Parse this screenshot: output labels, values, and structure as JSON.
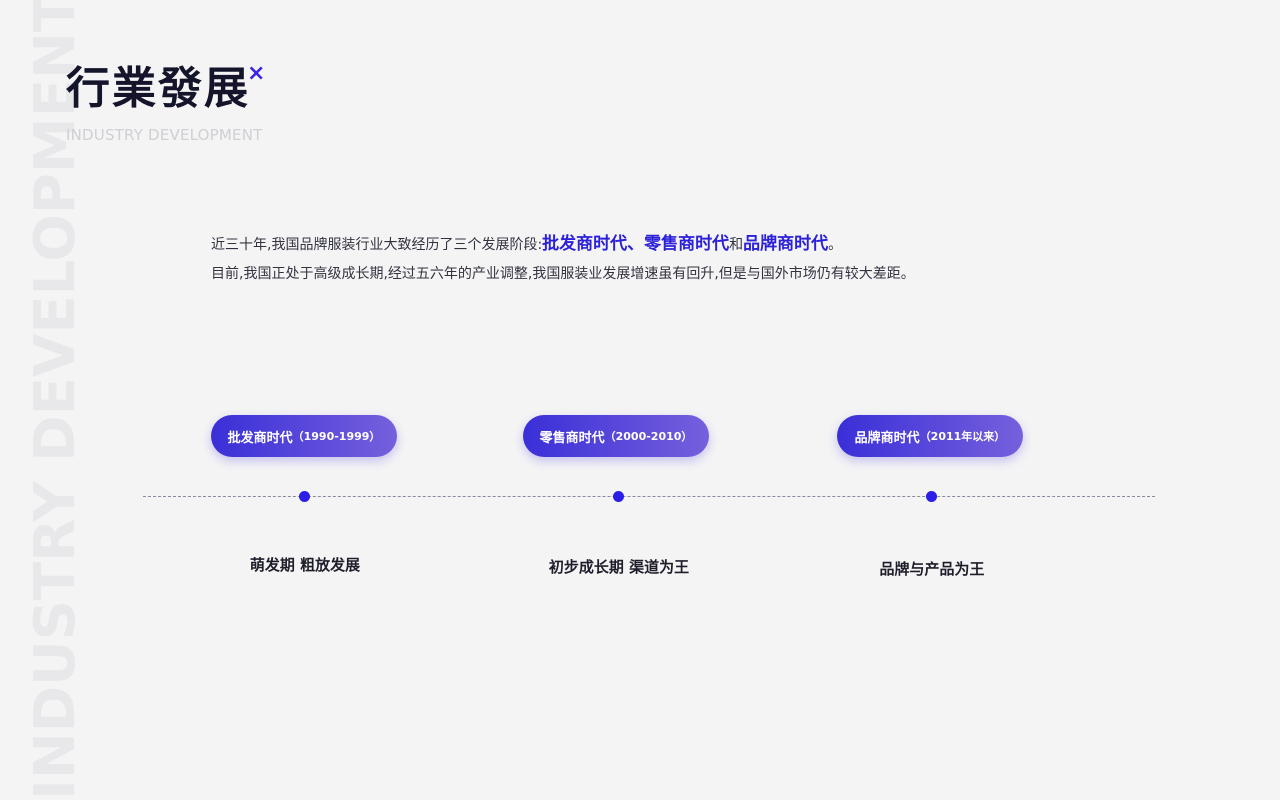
{
  "header": {
    "title": "行業發展",
    "title_mark": "×",
    "subtitle": "INDUSTRY DEVELOPMENT",
    "side_watermark": "INDUSTRY DEVELOPMENT"
  },
  "intro": {
    "line1_prefix": "近三十年,我国品牌服装行业大致经历了三个发展阶段:",
    "line1_highlight1": "批发商时代、零售商时代",
    "line1_connector": "和",
    "line1_highlight2": "品牌商时代",
    "line1_suffix": "。",
    "line2": "目前,我国正处于高级成长期,经过五六年的产业调整,我国服装业发展增速虽有回升,但是与国外市场仍有较大差距。"
  },
  "timeline": {
    "eras": [
      {
        "name": "批发商时代",
        "years": "（1990-1999）",
        "stage": "萌发期 粗放发展"
      },
      {
        "name": "零售商时代",
        "years": "（2000-2010）",
        "stage": "初步成长期 渠道为王"
      },
      {
        "name": "品牌商时代",
        "years": "（2011年以来）",
        "stage": "品牌与产品为王"
      }
    ]
  },
  "colors": {
    "accent": "#2c21d8",
    "pill_gradient_start": "#3a2fd8",
    "pill_gradient_end": "#7560dc",
    "dot": "#2b1ee6",
    "title": "#14142b"
  }
}
